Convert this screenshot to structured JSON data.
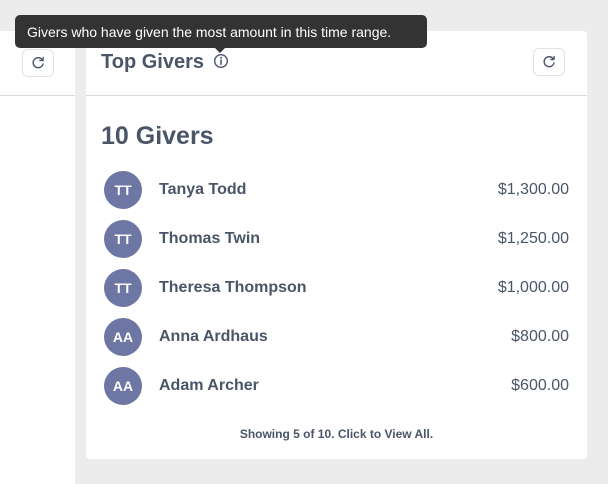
{
  "tooltip": {
    "text": "Givers who have given the most amount in this time range."
  },
  "card": {
    "title": "Top Givers",
    "count_heading": "10 Givers",
    "footer_link": "Showing 5 of 10. Click to View All.",
    "icons": {
      "info": "info-icon",
      "refresh": "refresh-icon"
    }
  },
  "givers": [
    {
      "initials": "TT",
      "name": "Tanya Todd",
      "amount": "$1,300.00"
    },
    {
      "initials": "TT",
      "name": "Thomas Twin",
      "amount": "$1,250.00"
    },
    {
      "initials": "TT",
      "name": "Theresa Thompson",
      "amount": "$1,000.00"
    },
    {
      "initials": "AA",
      "name": "Anna Ardhaus",
      "amount": "$800.00"
    },
    {
      "initials": "AA",
      "name": "Adam Archer",
      "amount": "$600.00"
    }
  ],
  "colors": {
    "avatar": "#6e76a3",
    "text": "#4a5568",
    "tooltip_bg": "#333333",
    "page_bg": "#ececec"
  }
}
